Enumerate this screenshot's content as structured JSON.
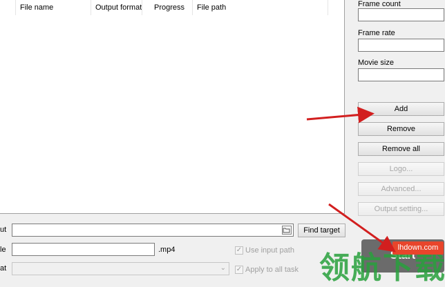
{
  "list": {
    "columns": [
      "File name",
      "Output format",
      "Progress",
      "File path"
    ]
  },
  "panel": {
    "frame_count_label": "Frame count",
    "frame_rate_label": "Frame rate",
    "movie_size_label": "Movie size",
    "add_label": "Add",
    "remove_label": "Remove",
    "remove_all_label": "Remove all",
    "logo_label": "Logo...",
    "advanced_label": "Advanced...",
    "output_setting_label": "Output setting..."
  },
  "bottom": {
    "output_label": "ut",
    "title_label": "le",
    "format_label": "at",
    "find_target_label": "Find target",
    "ext_label": ".mp4",
    "use_input_path_label": "Use input path",
    "apply_all_label": "Apply to all task",
    "start_label": "Start"
  },
  "watermark": {
    "badge": "lhdown.com",
    "text": "领航下载"
  },
  "colors": {
    "arrow": "#d21f1f",
    "start_bg": "#6b6b6b",
    "badge_bg": "#e8452b"
  }
}
